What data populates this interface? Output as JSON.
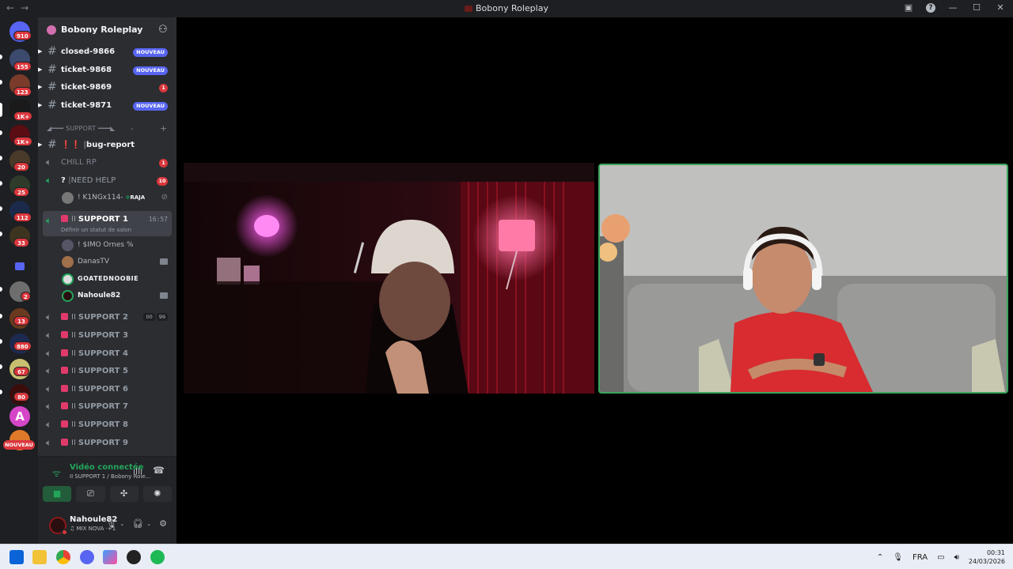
{
  "window": {
    "title": "Bobony Roleplay"
  },
  "servers": [
    {
      "badge": "910"
    },
    {
      "badge": "155"
    },
    {
      "badge": "123"
    },
    {
      "badge": "1K+"
    },
    {
      "badge": "1K+"
    },
    {
      "badge": "20"
    },
    {
      "badge": "25"
    },
    {
      "badge": "112"
    },
    {
      "badge": "33"
    },
    {
      "badge": ""
    },
    {
      "badge": "2"
    },
    {
      "badge": "13"
    },
    {
      "badge": "880"
    },
    {
      "badge": "67"
    },
    {
      "badge": "80"
    },
    {
      "badge": ""
    },
    {
      "badge": "NOUVEAU"
    }
  ],
  "guild": {
    "name": "Bobony Roleplay"
  },
  "channels": {
    "tickets": [
      {
        "name": "closed-9866",
        "badge": "NOUVEAU"
      },
      {
        "name": "ticket-9868",
        "badge": "NOUVEAU"
      },
      {
        "name": "ticket-9869",
        "badge": "1"
      },
      {
        "name": "ticket-9871",
        "badge": "NOUVEAU"
      }
    ],
    "category": "◢━━━ SUPPORT ━━━◣",
    "bug_report": {
      "prefix": "❗❗",
      "name": "bug-report"
    },
    "chill": {
      "name": "CHILL RP",
      "badge": "1"
    },
    "need_help": {
      "prefix": "?",
      "name": "NEED HELP",
      "badge": "10",
      "member": "! K1NGx114-",
      "member_tag": "RAJA"
    },
    "support1": {
      "name": "SUPPORT 1",
      "time": "16:57",
      "status": "Définir un statut de salon"
    },
    "support1_members": [
      {
        "name": "! $IMO Ornes %"
      },
      {
        "name": "DanasTV"
      },
      {
        "name": "GOATEDNOOBIE"
      },
      {
        "name": "Nahoule82"
      }
    ],
    "support2": {
      "name": "SUPPORT 2",
      "count_a": "00",
      "count_b": "99"
    },
    "supports": [
      "SUPPORT 3",
      "SUPPORT 4",
      "SUPPORT 5",
      "SUPPORT 6",
      "SUPPORT 7",
      "SUPPORT 8",
      "SUPPORT 9"
    ]
  },
  "voice": {
    "title": "Vidéo connectée",
    "sub": "II SUPPORT 1 / Bobony Role..."
  },
  "user": {
    "name": "Nahoule82",
    "activity": "♫ MIX NOVA ·+1"
  },
  "taskbar": {
    "lang": "FRA",
    "time": "00:31",
    "date": "24/03/2026"
  },
  "colors": {
    "accent": "#5865f2",
    "online": "#23a55a",
    "alert": "#da373c"
  }
}
